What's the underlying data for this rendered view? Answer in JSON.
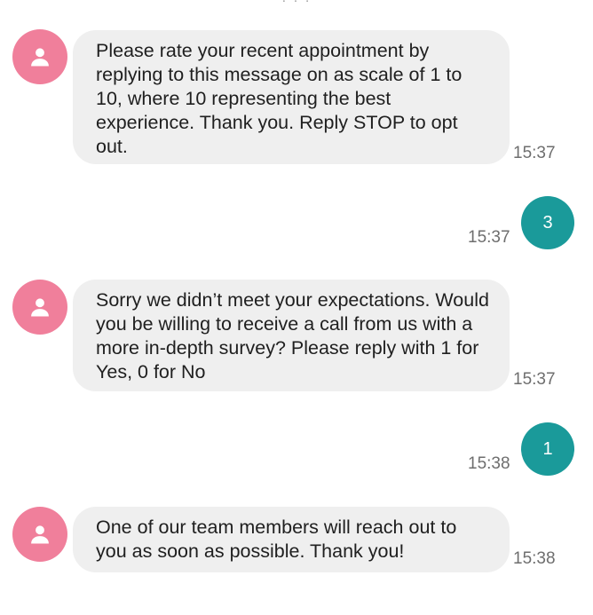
{
  "header": {
    "fragment": "· · ·"
  },
  "messages": [
    {
      "direction": "incoming",
      "avatar_icon": "person-icon",
      "text": "Please rate your recent appointment by replying to this message on as scale of 1 to 10, where 10 representing the best experience. Thank you. Reply STOP to opt out.",
      "time": "15:37"
    },
    {
      "direction": "outgoing",
      "text": "3",
      "time": "15:37"
    },
    {
      "direction": "incoming",
      "avatar_icon": "person-icon",
      "text": "Sorry we didn’t meet your expectations. Would you be willing to receive a call from us with a more in-depth survey? Please reply with 1 for Yes, 0 for No",
      "time": "15:37"
    },
    {
      "direction": "outgoing",
      "text": "1",
      "time": "15:38"
    },
    {
      "direction": "incoming",
      "avatar_icon": "person-icon",
      "text": "One of our team members will reach out to you as soon as possible. Thank you!",
      "time": "15:38"
    }
  ],
  "colors": {
    "avatar_bg": "#f07f9b",
    "incoming_bubble_bg": "#efefef",
    "outgoing_bubble_bg": "#1a9a9a",
    "timestamp": "#6e6e6e"
  }
}
